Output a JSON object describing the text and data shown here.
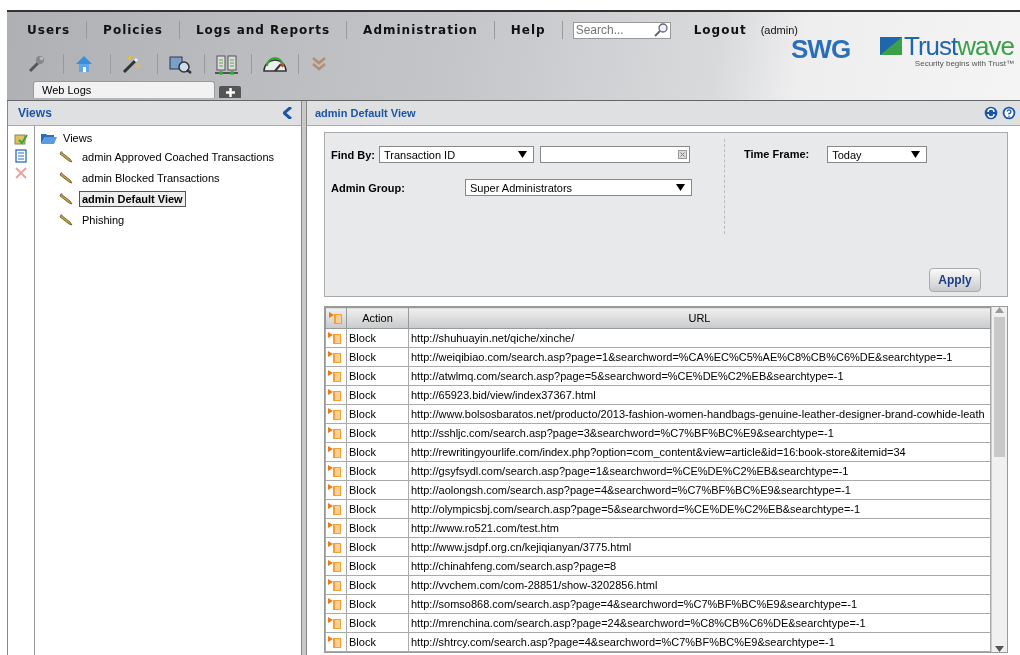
{
  "menu": [
    {
      "label": "Users"
    },
    {
      "label": "Policies"
    },
    {
      "label": "Logs and Reports"
    },
    {
      "label": "Administration"
    },
    {
      "label": "Help"
    }
  ],
  "search": {
    "placeholder": "Search..."
  },
  "logout": "Logout",
  "user": "(admin)",
  "product": "SWG",
  "brand": {
    "name_start": "Trust",
    "name_end": "wave",
    "tagline": "Security begins with Trust™"
  },
  "tabs": [
    {
      "label": "Web Logs",
      "selected": true
    }
  ],
  "views_panel": {
    "title": "Views",
    "tree": {
      "label": "Views",
      "expanded": true,
      "children": [
        {
          "label": "admin Approved Coached Transactions",
          "selected": false
        },
        {
          "label": "admin Blocked Transactions",
          "selected": false
        },
        {
          "label": "admin Default View",
          "selected": true
        },
        {
          "label": "Phishing",
          "selected": false
        }
      ]
    }
  },
  "main": {
    "title": "admin Default View",
    "filters": {
      "find_by_label": "Find By:",
      "find_by_value": "Transaction ID",
      "time_frame_label": "Time Frame:",
      "time_frame_value": "Today",
      "admin_group_label": "Admin Group:",
      "admin_group_value": "Super Administrators",
      "apply": "Apply"
    },
    "table": {
      "columns": [
        "Action",
        "URL"
      ],
      "rows": [
        {
          "action": "Block",
          "url": "http://shuhuayin.net/qiche/xinche/"
        },
        {
          "action": "Block",
          "url": "http://weiqibiao.com/search.asp?page=1&searchword=%CA%EC%C5%AE%C8%CB%C6%DE&searchtype=-1"
        },
        {
          "action": "Block",
          "url": "http://atwlmq.com/search.asp?page=5&searchword=%CE%DE%C2%EB&searchtype=-1"
        },
        {
          "action": "Block",
          "url": "http://65923.bid/view/index37367.html"
        },
        {
          "action": "Block",
          "url": "http://www.bolsosbaratos.net/producto/2013-fashion-women-handbags-genuine-leather-designer-brand-cowhide-leath"
        },
        {
          "action": "Block",
          "url": "http://sshljc.com/search.asp?page=3&searchword=%C7%BF%BC%E9&searchtype=-1"
        },
        {
          "action": "Block",
          "url": "http://rewritingyourlife.com/index.php?option=com_content&view=article&id=16:book-store&itemid=34"
        },
        {
          "action": "Block",
          "url": "http://gsyfsydl.com/search.asp?page=1&searchword=%CE%DE%C2%EB&searchtype=-1"
        },
        {
          "action": "Block",
          "url": "http://aolongsh.com/search.asp?page=4&searchword=%C7%BF%BC%E9&searchtype=-1"
        },
        {
          "action": "Block",
          "url": "http://olympicsbj.com/search.asp?page=5&searchword=%CE%DE%C2%EB&searchtype=-1"
        },
        {
          "action": "Block",
          "url": "http://www.ro521.com/test.htm"
        },
        {
          "action": "Block",
          "url": "http://www.jsdpf.org.cn/kejiqianyan/3775.html"
        },
        {
          "action": "Block",
          "url": "http://chinahfeng.com/search.asp?page=8"
        },
        {
          "action": "Block",
          "url": "http://vvchem.com/com-28851/show-3202856.html"
        },
        {
          "action": "Block",
          "url": "http://somso868.com/search.asp?page=4&searchword=%C7%BF%BC%E9&searchtype=-1"
        },
        {
          "action": "Block",
          "url": "http://mrenchina.com/search.asp?page=24&searchword=%C8%CB%C6%DE&searchtype=-1"
        },
        {
          "action": "Block",
          "url": "http://shtrcy.com/search.asp?page=4&searchword=%C7%BF%BC%E9&searchtype=-1"
        }
      ]
    }
  }
}
